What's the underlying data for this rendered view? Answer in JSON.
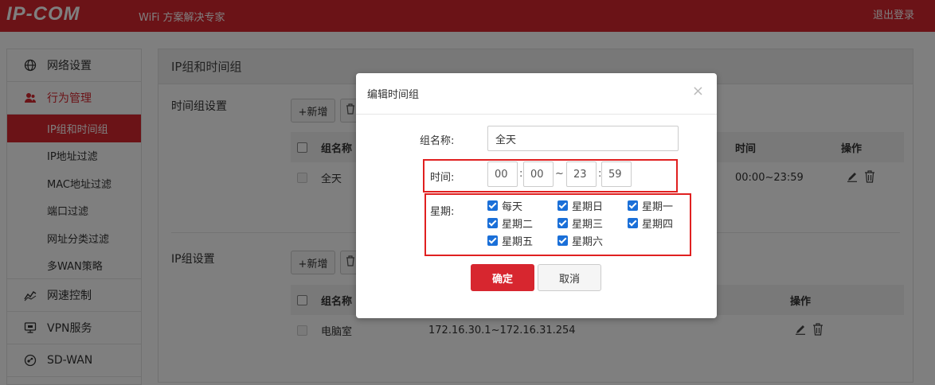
{
  "header": {
    "logo": "IP-COM",
    "slogan": "WiFi 方案解决专家",
    "logout": "退出登录",
    "bg_color": "#d7262f"
  },
  "sidebar": {
    "items": [
      {
        "label": "网络设置",
        "icon": "globe-icon"
      },
      {
        "label": "行为管理",
        "icon": "users-icon",
        "active": true
      },
      {
        "label": "网速控制",
        "icon": "chart-line-icon"
      },
      {
        "label": "VPN服务",
        "icon": "monitor-icon"
      },
      {
        "label": "SD-WAN",
        "icon": "network-icon"
      }
    ],
    "subitems": [
      "IP组和时间组",
      "IP地址过滤",
      "MAC地址过滤",
      "端口过滤",
      "网址分类过滤",
      "多WAN策略"
    ],
    "active_subitem": "IP组和时间组"
  },
  "main": {
    "title": "IP组和时间组",
    "time_group": {
      "section_label": "时间组设置",
      "add_label": "+新增",
      "columns": [
        "组名称",
        "时间",
        "操作"
      ],
      "rows": [
        {
          "name": "全天",
          "time": "00:00~23:59"
        }
      ]
    },
    "ip_group": {
      "section_label": "IP组设置",
      "add_label": "+新增",
      "columns": [
        "组名称",
        "操作"
      ],
      "rows": [
        {
          "name": "电脑室",
          "range": "172.16.30.1~172.16.31.254"
        }
      ]
    }
  },
  "modal": {
    "title": "编辑时间组",
    "close": "×",
    "name_label": "组名称:",
    "name_value": "全天",
    "time_label": "时间:",
    "start_hour": "00",
    "start_min": "00",
    "range_sep": "~",
    "colon": ":",
    "end_hour": "23",
    "end_min": "59",
    "week_label": "星期:",
    "days": [
      {
        "label": "每天",
        "checked": true
      },
      {
        "label": "星期日",
        "checked": true
      },
      {
        "label": "星期一",
        "checked": true
      },
      {
        "label": "星期二",
        "checked": true
      },
      {
        "label": "星期三",
        "checked": true
      },
      {
        "label": "星期四",
        "checked": true
      },
      {
        "label": "星期五",
        "checked": true
      },
      {
        "label": "星期六",
        "checked": true
      }
    ],
    "ok_label": "确定",
    "cancel_label": "取消",
    "highlight_color": "#e02020"
  }
}
